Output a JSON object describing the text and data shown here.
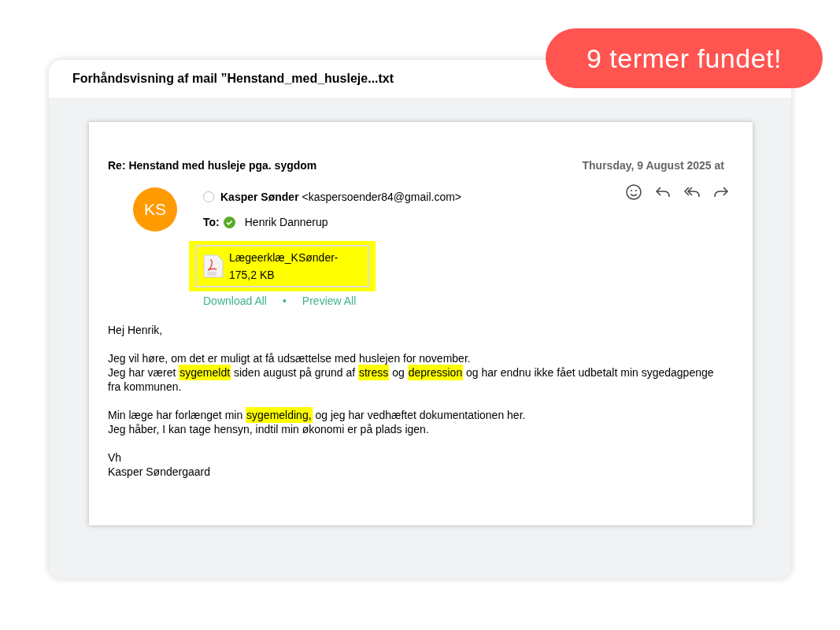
{
  "badge": {
    "label": "9 termer fundet!"
  },
  "window": {
    "title": "Forhåndsvisning af mail ”Henstand_med_husleje...txt"
  },
  "email": {
    "subject": "Re: Henstand med husleje pga. sygdom",
    "date": "Thursday, 9 August 2025 at",
    "avatar": "KS",
    "sender_name": "Kasper Sønder",
    "sender_address": "<kaspersoender84@gmail.com>",
    "to_label": "To:",
    "recipient": "Henrik Dannerup",
    "attachment": {
      "name": "Lægeerklæ_KSønder-",
      "size": "175,2 KB",
      "highlighted": true
    },
    "links": [
      "Download All",
      "•",
      "Preview All"
    ],
    "paragraphs": [
      {
        "lines": [
          [
            {
              "text": "Hej Henrik,",
              "highlighted": false
            }
          ]
        ]
      },
      {
        "lines": [
          [
            {
              "text": "Jeg vil høre, om det er muligt at få udsættelse med huslejen for november.",
              "highlighted": false
            }
          ],
          [
            {
              "text": "Jeg har været ",
              "highlighted": false
            },
            {
              "text": "sygemeldt",
              "highlighted": true
            },
            {
              "text": " siden august på grund af ",
              "highlighted": false
            },
            {
              "text": "stress",
              "highlighted": true
            },
            {
              "text": " og ",
              "highlighted": false
            },
            {
              "text": "depression",
              "highlighted": true
            },
            {
              "text": " og har endnu ikke fået udbetalt min sygedagpenge fra kommunen.",
              "highlighted": false
            }
          ]
        ]
      },
      {
        "lines": [
          [
            {
              "text": "Min læge har forlænget min ",
              "highlighted": false
            },
            {
              "text": "sygemelding,",
              "highlighted": true
            },
            {
              "text": " og jeg har vedhæftet dokumentationen her.",
              "highlighted": false
            }
          ],
          [
            {
              "text": "Jeg håber, I kan tage hensyn, indtil min økonomi er på plads igen.",
              "highlighted": false
            }
          ]
        ]
      },
      {
        "lines": [
          [
            {
              "text": "Vh",
              "highlighted": false
            }
          ],
          [
            {
              "text": "Kasper Søndergaard",
              "highlighted": false
            }
          ]
        ]
      }
    ]
  }
}
